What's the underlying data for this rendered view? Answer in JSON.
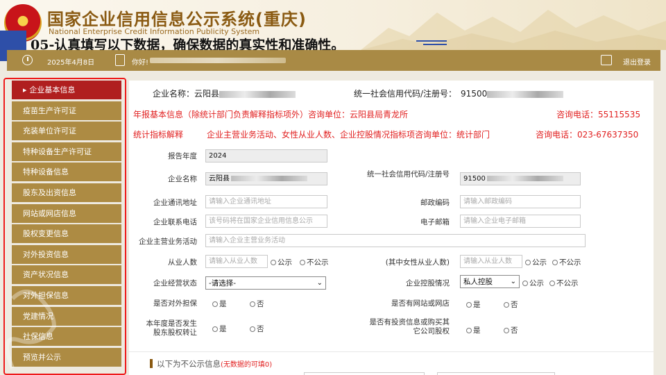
{
  "header": {
    "title": "国家企业信用信息公示系统(重庆)",
    "subtitle": "National Enterprise Credit Information Publicity System",
    "overlay_caption": "05-认真填写以下数据，确保数据的真实性和准确性。"
  },
  "topbar": {
    "date": "2025年4月8日",
    "greeting": "你好!",
    "logout": "退出登录"
  },
  "sidebar": {
    "items": [
      {
        "label": "企业基本信息",
        "active": true
      },
      {
        "label": "疫苗生产许可证"
      },
      {
        "label": "充装单位许可证"
      },
      {
        "label": "特种设备生产许可证"
      },
      {
        "label": "特种设备信息"
      },
      {
        "label": "股东及出资信息"
      },
      {
        "label": "网站或网店信息"
      },
      {
        "label": "股权变更信息"
      },
      {
        "label": "对外投资信息"
      },
      {
        "label": "资产状况信息"
      },
      {
        "label": "对外担保信息"
      },
      {
        "label": "党建情况"
      },
      {
        "label": "社保信息"
      },
      {
        "label": "预览并公示"
      }
    ],
    "active_arrow": "▶"
  },
  "company": {
    "name_label": "企业名称：",
    "name_value": "云阳县",
    "code_label": "统一社会信用代码/注册号：",
    "code_value": "91500"
  },
  "contacts": {
    "line1_text": "年报基本信息（除统计部门负责解释指标项外）咨询单位：云阳县局青龙所",
    "line1_phone": "咨询电话：55115535",
    "line2_prefix": "统计指标解释",
    "line2_text": "企业主营业务活动、女性从业人数、企业控股情况指标项咨询单位：统计部门",
    "line2_phone": "咨询电话：023-67637350"
  },
  "form": {
    "report_year_label": "报告年度",
    "report_year_value": "2024",
    "ent_name_label": "企业名称",
    "ent_name_value": "云阳县",
    "uscc_label": "统一社会信用代码/注册号",
    "uscc_value": "91500",
    "address_label": "企业通讯地址",
    "address_placeholder": "请输入企业通讯地址",
    "postcode_label": "邮政编码",
    "postcode_placeholder": "请输入邮政编码",
    "phone_label": "企业联系电话",
    "phone_placeholder": "该号码将在国家企业信用信息公示",
    "email_label": "电子邮箱",
    "email_placeholder": "请输入企业电子邮箱",
    "business_label": "企业主营业务活动",
    "business_placeholder": "请输入企业主营业务活动",
    "employees_label": "从业人数",
    "employees_placeholder": "请输入从业人数",
    "female_label": "(其中女性从业人数)",
    "female_placeholder": "请输入从业人数",
    "public_option": "公示",
    "private_option": "不公示",
    "status_label": "企业经营状态",
    "status_value": "-请选择-",
    "holding_label": "企业控股情况",
    "holding_value": "私人控股",
    "guarantee_label": "是否对外担保",
    "website_label": "是否有网站或网店",
    "transfer_label": "本年度是否发生股东股权转让",
    "invest_label": "是否有投资信息或购买其它公司股权",
    "yes_option": "是",
    "no_option": "否"
  },
  "notice": {
    "text": "以下为不公示信息",
    "hint": "(无数据的可填0)"
  },
  "colors": {
    "sidebar_item": "#ad8b43",
    "sidebar_active": "#b01f1f",
    "topbar": "#a98a45",
    "highlight_frame": "#ee1a1a",
    "notice_red": "#e12020"
  }
}
